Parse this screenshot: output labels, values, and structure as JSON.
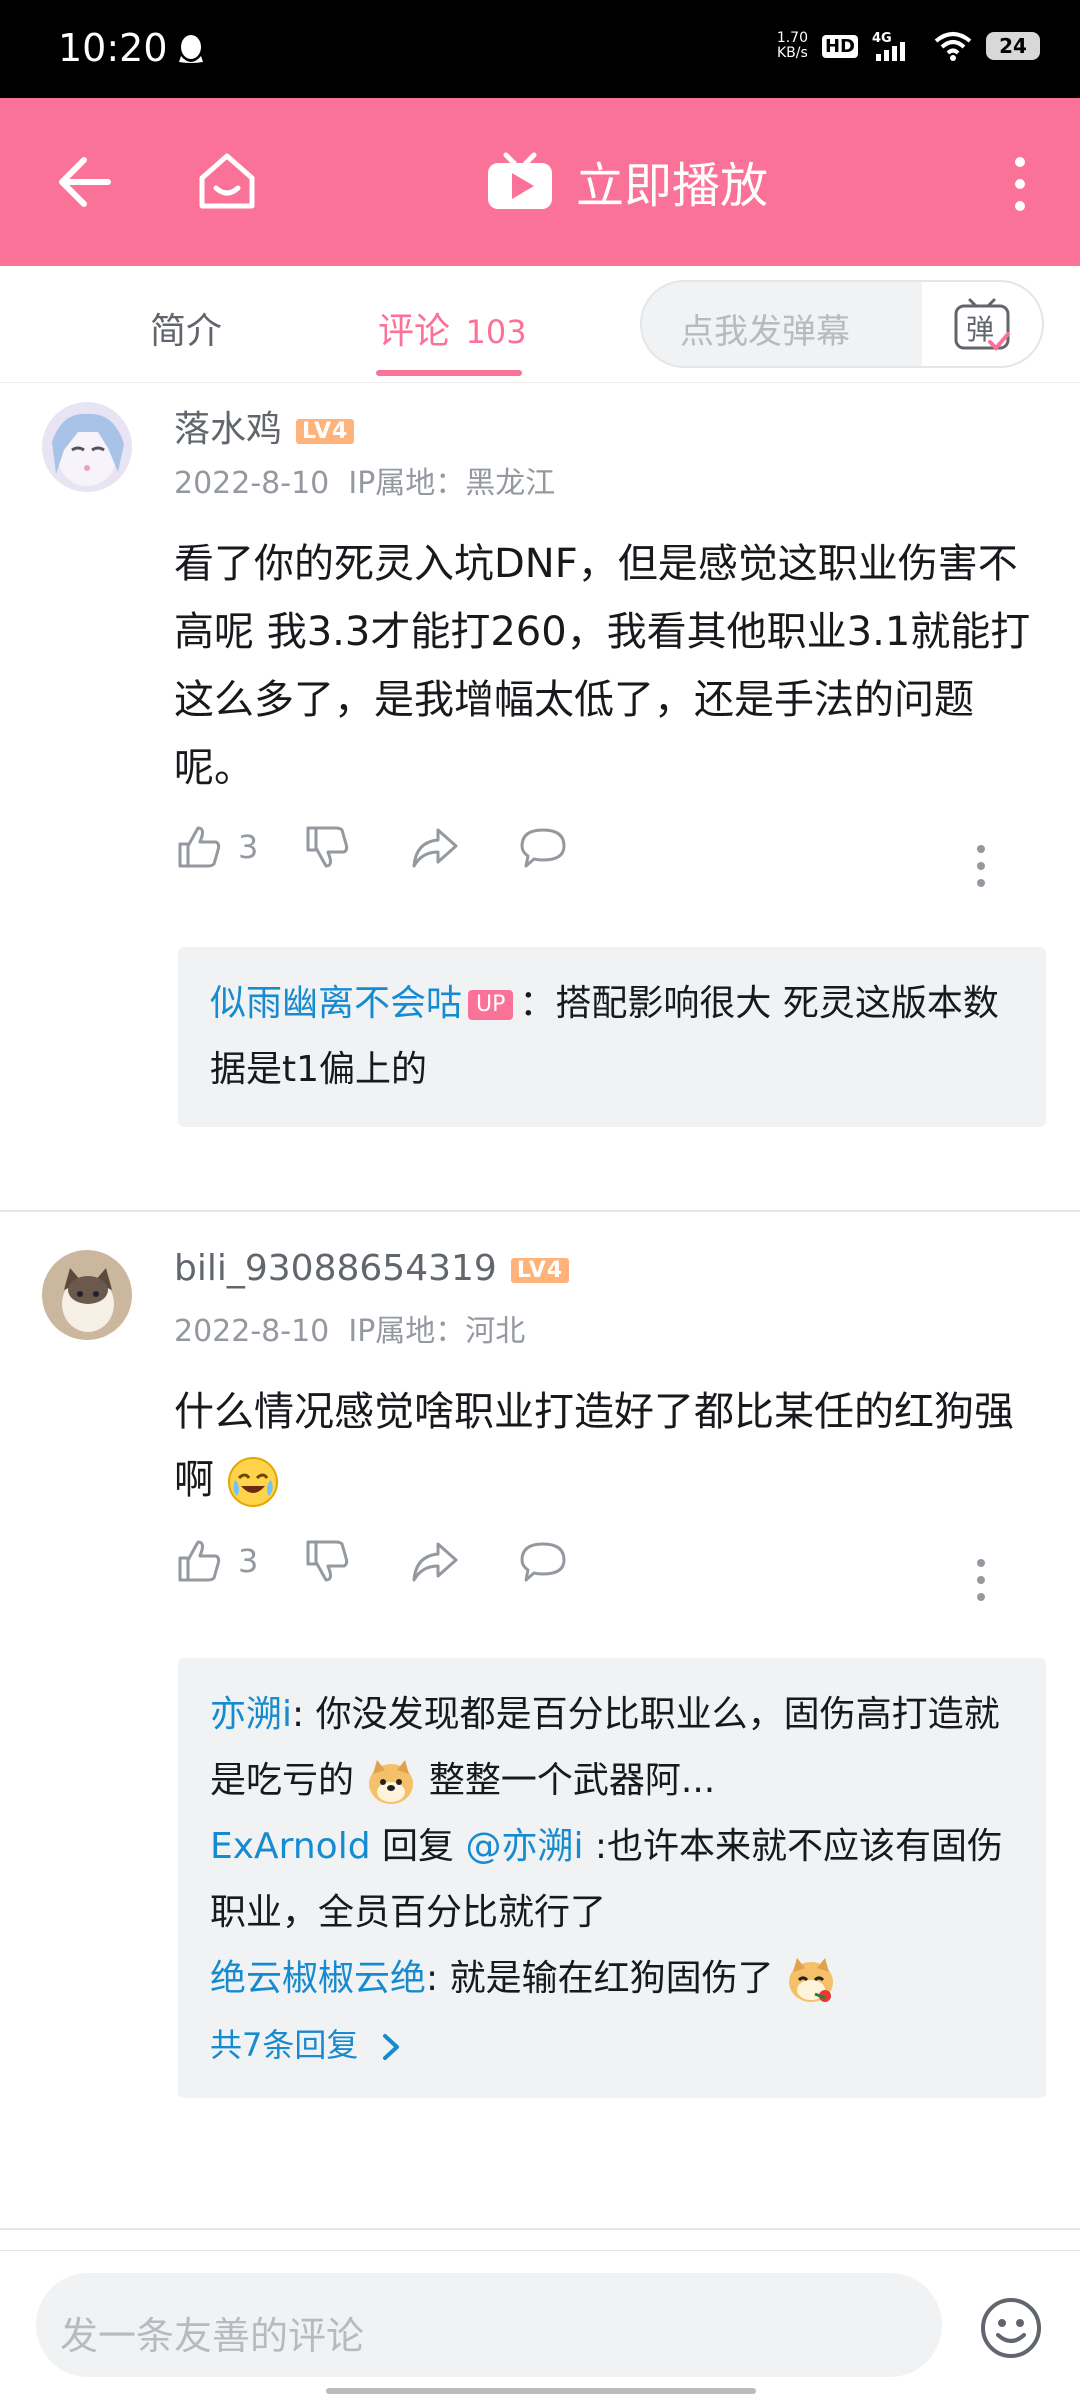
{
  "status_bar": {
    "time": "10:20",
    "net_speed_value": "1.70",
    "net_speed_unit": "KB/s",
    "hd": "HD",
    "network": "4G",
    "battery": "24"
  },
  "header": {
    "play_label": "立即播放",
    "background_color": "#fb7299"
  },
  "tabs": {
    "intro": "简介",
    "comments": "评论",
    "comments_count": "103",
    "danmaku_placeholder": "点我发弹幕",
    "danmaku_button_glyph": "弹"
  },
  "comments": [
    {
      "username": "落水鸡",
      "level": "LV4",
      "date": "2022-8-10",
      "ip": "IP属地：黑龙江",
      "text": "看了你的死灵入坑DNF，但是感觉这职业伤害不高呢 我3.3才能打260，我看其他职业3.1就能打这么多了，是我增幅太低了，还是手法的问题呢。",
      "likes": "3",
      "replies": [
        {
          "name": "似雨幽离不会咕",
          "badge": "UP",
          "sep": "：",
          "text": "搭配影响很大 死灵这版本数据是t1偏上的"
        }
      ]
    },
    {
      "username": "bili_93088654319",
      "level": "LV4",
      "date": "2022-8-10",
      "ip": "IP属地：河北",
      "text": "什么情况感觉啥职业打造好了都比某任的红狗强啊",
      "likes": "3",
      "replies": [
        {
          "name": "亦溯i",
          "sep": ": ",
          "text_a": "你没发现都是百分比职业么，固伤高打造就是吃亏的",
          "text_b": " 整整一个武器阿..."
        },
        {
          "name": "ExArnold",
          "reply_word": " 回复 ",
          "mention": "@亦溯i",
          "text": " :也许本来就不应该有固伤职业，全员百分比就行了"
        },
        {
          "name": "绝云椒椒云绝",
          "sep": ": ",
          "text": "就是输在红狗固伤了"
        }
      ],
      "more_replies": "共7条回复"
    }
  ],
  "bottom_bar": {
    "placeholder": "发一条友善的评论"
  }
}
